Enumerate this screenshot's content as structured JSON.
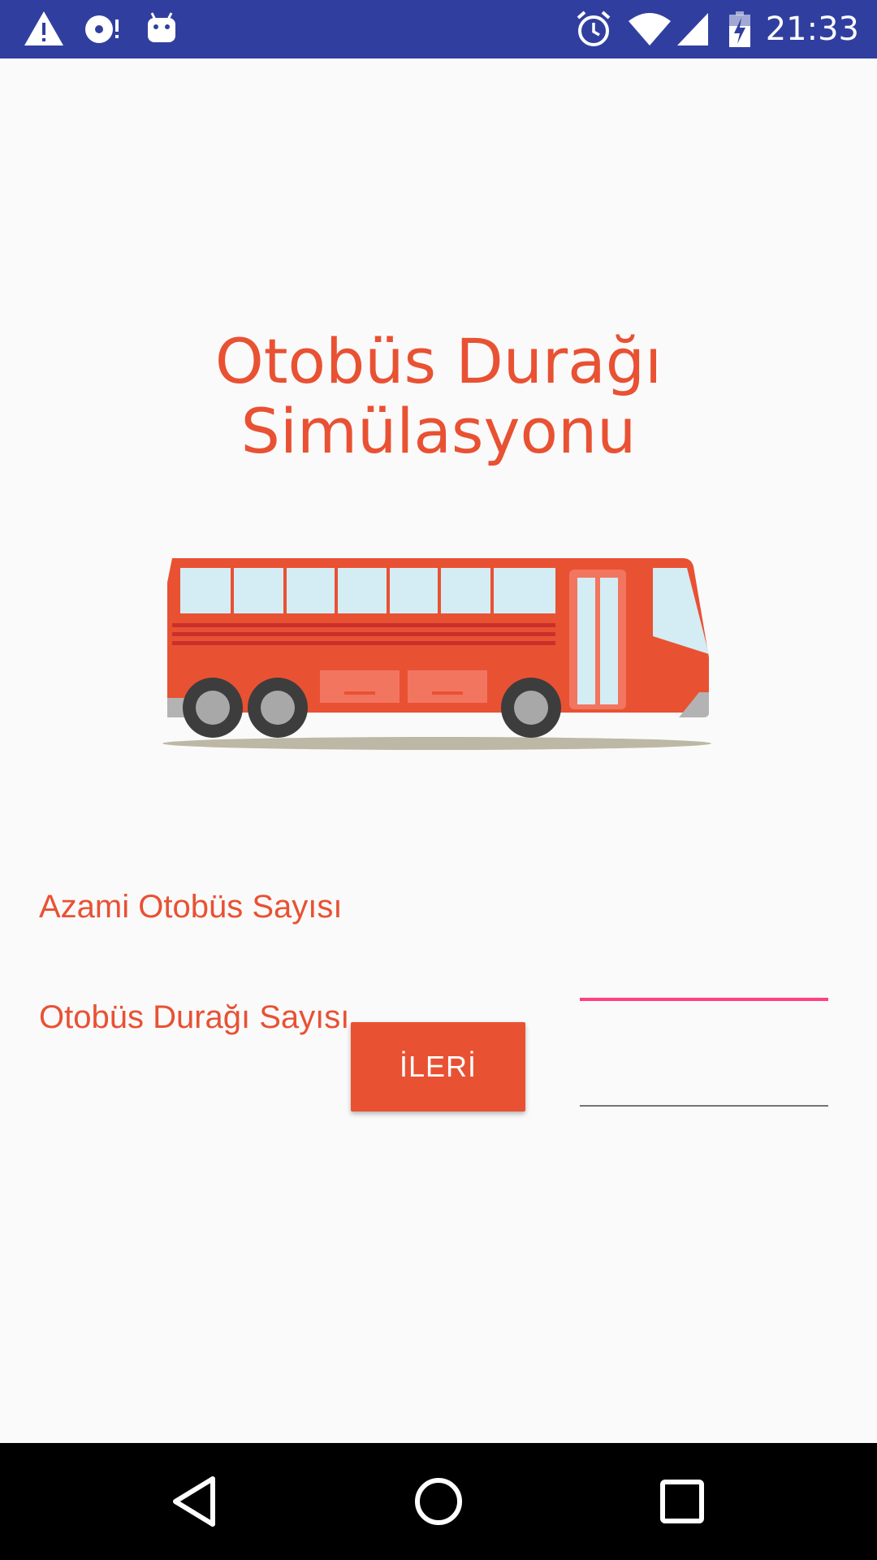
{
  "status_bar": {
    "time": "21:33",
    "background_color": "#303f9f",
    "icons": [
      "warning-icon",
      "cd-sync-icon",
      "android-debug-icon",
      "alarm-icon",
      "wifi-icon",
      "signal-icon",
      "battery-charging-icon"
    ]
  },
  "app": {
    "title_line1": "Otobüs Durağı",
    "title_line2": "Simülasyonu",
    "accent_color": "#e95133",
    "illustration": "bus-illustration"
  },
  "form": {
    "max_bus_label": "Azami Otobüs Sayısı",
    "max_bus_value": "",
    "bus_stop_label": "Otobüs Durağı Sayısı",
    "bus_stop_value": "",
    "focus_underline_color": "#ff4081"
  },
  "actions": {
    "next_label": "İLERİ"
  },
  "nav_bar": {
    "buttons": [
      "back-icon",
      "home-icon",
      "recents-icon"
    ]
  }
}
